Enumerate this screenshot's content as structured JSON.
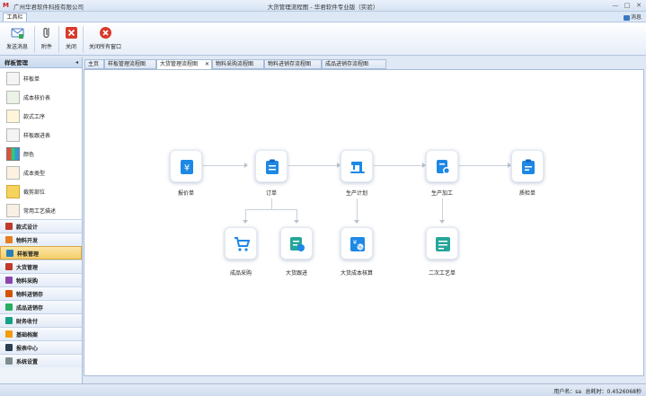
{
  "window": {
    "company": "广州华君软件科技有限公司",
    "title": "大货管理流程图 - 华君软件专业版（实验）",
    "minimize": "—",
    "maximize": "□",
    "close": "✕"
  },
  "ribbon": {
    "tab": "工具栏",
    "message_label": "消息",
    "buttons": [
      {
        "label": "发送消息",
        "icon": "send-message-icon"
      },
      {
        "label": "附件",
        "icon": "paperclip-icon"
      },
      {
        "label": "关闭",
        "icon": "close-red-icon"
      },
      {
        "label": "关闭所有窗口",
        "icon": "close-all-icon"
      }
    ]
  },
  "sidebar": {
    "header": "样板管理",
    "pin": "◂",
    "items": [
      {
        "label": "样板单"
      },
      {
        "label": "成本核价表"
      },
      {
        "label": "款式工序"
      },
      {
        "label": "样板跟进表"
      },
      {
        "label": "颜色"
      },
      {
        "label": "成本类型"
      },
      {
        "label": "裁剪部位"
      },
      {
        "label": "常用工艺描述"
      }
    ],
    "groups": [
      {
        "label": "款式设计",
        "color": "#c0392b"
      },
      {
        "label": "物料开发",
        "color": "#e67e22"
      },
      {
        "label": "样板管理",
        "color": "#2980b9",
        "active": true
      },
      {
        "label": "大货管理",
        "color": "#c0392b"
      },
      {
        "label": "物料采购",
        "color": "#8e44ad"
      },
      {
        "label": "物料进销存",
        "color": "#d35400"
      },
      {
        "label": "成品进销存",
        "color": "#27ae60"
      },
      {
        "label": "财务收付",
        "color": "#16a085"
      },
      {
        "label": "基础档案",
        "color": "#f39c12"
      },
      {
        "label": "报表中心",
        "color": "#2c3e50"
      },
      {
        "label": "系统设置",
        "color": "#7f8c8d"
      }
    ]
  },
  "doc_tabs": [
    {
      "label": "主页"
    },
    {
      "label": "样板管理流程图"
    },
    {
      "label": "大货管理流程图",
      "active": true,
      "close": "✕"
    },
    {
      "label": "物料采购流程图"
    },
    {
      "label": "物料进销存流程图"
    },
    {
      "label": "成品进销存流程图"
    }
  ],
  "flow": {
    "nodes": [
      {
        "id": "quote",
        "label": "报价单"
      },
      {
        "id": "order",
        "label": "订单"
      },
      {
        "id": "plan",
        "label": "生产计划"
      },
      {
        "id": "process",
        "label": "生产加工"
      },
      {
        "id": "qc",
        "label": "质检单"
      },
      {
        "id": "purchase",
        "label": "成品采购"
      },
      {
        "id": "follow",
        "label": "大货跟进"
      },
      {
        "id": "cost",
        "label": "大货成本核算"
      },
      {
        "id": "secondary",
        "label": "二次工艺单"
      }
    ],
    "accent": "#1e88e5"
  },
  "status": {
    "user": "用户名：sa",
    "elapsed": "总耗时：0.4526068秒"
  }
}
